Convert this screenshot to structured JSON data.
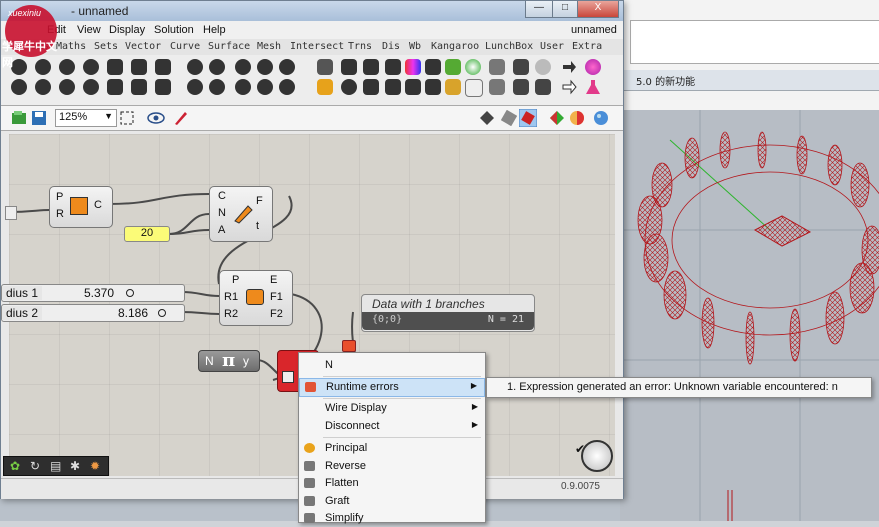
{
  "watermark": {
    "line1": "xuexiniu",
    "line2": "学犀牛中文网"
  },
  "window": {
    "title": "- unnamed",
    "doc_name": "unnamed"
  },
  "window_controls": {
    "minimize": "—",
    "maximize": "□",
    "close": "X"
  },
  "menu": [
    "Edit",
    "View",
    "Display",
    "Solution",
    "Help"
  ],
  "tabs": [
    "ams",
    "Maths",
    "Sets",
    "Vector",
    "Curve",
    "Surface",
    "Mesh",
    "Intersect",
    "Trns",
    "Dis",
    "Wb",
    "Kangaroo",
    "LunchBox",
    "User",
    "Extra"
  ],
  "toolbar": {
    "zoom": "125%"
  },
  "rhino": {
    "tab_label": "5.0 的新功能"
  },
  "canvas": {
    "circle_comp": {
      "inputs": [
        "P",
        "R"
      ],
      "outputs": [
        "C"
      ]
    },
    "divide_comp": {
      "inputs": [
        "C",
        "N",
        "A"
      ],
      "outputs": [
        "F",
        "t"
      ]
    },
    "number_panel": "20",
    "sliders": [
      {
        "name": "dius 1",
        "value": "5.370"
      },
      {
        "name": "dius 2",
        "value": "8.186"
      }
    ],
    "ellipse_comp": {
      "inputs": [
        "P",
        "R1",
        "R2"
      ],
      "outputs": [
        "E",
        "F1",
        "F2"
      ]
    },
    "data_panel": {
      "title": "Data with 1 branches",
      "path": "{0;0}",
      "count": "N = 21"
    },
    "expression_comp": {
      "input": "N",
      "symbol": "π",
      "output": "y"
    }
  },
  "context_menu": {
    "items": [
      {
        "label": "N"
      },
      {
        "label": "Runtime errors",
        "submenu": true
      },
      {
        "label": "Wire Display",
        "submenu": true
      },
      {
        "label": "Disconnect",
        "submenu": true
      },
      {
        "label": "Principal"
      },
      {
        "label": "Reverse"
      },
      {
        "label": "Flatten"
      },
      {
        "label": "Graft"
      },
      {
        "label": "Simplify"
      }
    ],
    "submenu_text": "1. Expression generated an error: Unknown variable encountered: n"
  },
  "status": {
    "version": "0.9.0075"
  },
  "colors": {
    "accent_red": "#d9262b",
    "selection": "#cde3f7",
    "number_yellow": "#fbfb78"
  }
}
